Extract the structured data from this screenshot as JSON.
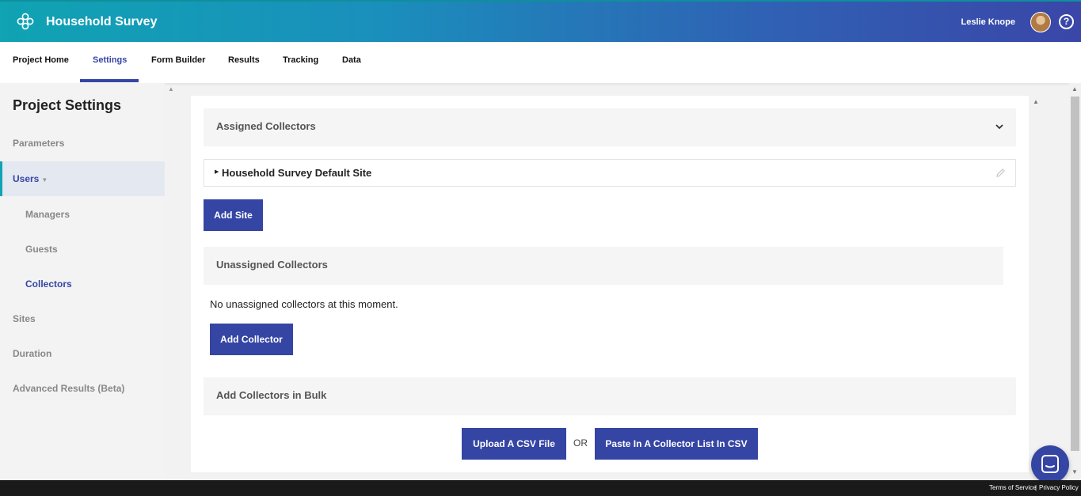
{
  "app": {
    "title": "Household Survey",
    "user_name": "Leslie Knope",
    "help_glyph": "?"
  },
  "nav": {
    "tabs": [
      {
        "label": "Project Home"
      },
      {
        "label": "Settings",
        "active": true
      },
      {
        "label": "Form Builder"
      },
      {
        "label": "Results"
      },
      {
        "label": "Tracking"
      },
      {
        "label": "Data"
      }
    ]
  },
  "sidebar": {
    "title": "Project Settings",
    "items": [
      {
        "label": "Parameters"
      },
      {
        "label": "Users",
        "selected": true,
        "expandable": true
      },
      {
        "label": "Managers",
        "sub": true
      },
      {
        "label": "Guests",
        "sub": true
      },
      {
        "label": "Collectors",
        "sub": true,
        "active": true
      },
      {
        "label": "Sites"
      },
      {
        "label": "Duration"
      },
      {
        "label": "Advanced Results (Beta)"
      }
    ]
  },
  "main": {
    "assigned": {
      "title": "Assigned Collectors",
      "site_name": "Household Survey Default Site",
      "add_site_label": "Add Site"
    },
    "unassigned": {
      "title": "Unassigned Collectors",
      "empty_message": "No unassigned collectors at this moment.",
      "add_collector_label": "Add Collector"
    },
    "bulk": {
      "title": "Add Collectors in Bulk",
      "upload_label": "Upload A CSV File",
      "or_label": "OR",
      "paste_label": "Paste In A Collector List In CSV"
    }
  },
  "footer": {
    "terms": "Terms of Service",
    "separator": "|",
    "privacy": "Privacy Policy"
  },
  "colors": {
    "accent": "#3545a4",
    "teal": "#10a3b3"
  },
  "icons": [
    "app-logo-icon",
    "help-icon",
    "chevron-down-icon",
    "caret-right-icon",
    "pencil-icon",
    "chat-icon"
  ]
}
